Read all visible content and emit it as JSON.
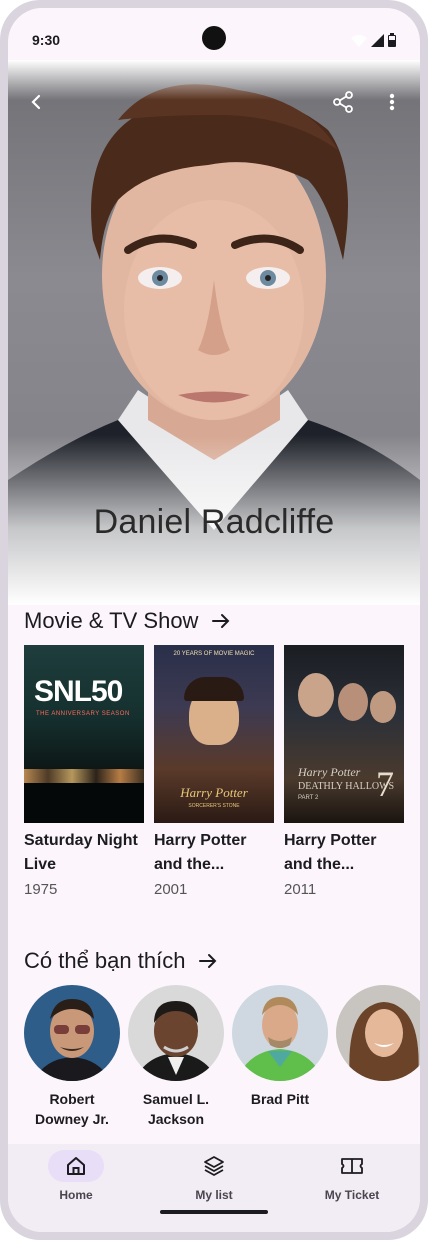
{
  "status_bar": {
    "time": "9:30"
  },
  "header": {
    "person_name": "Daniel Radcliffe",
    "back_icon": "back-arrow-icon",
    "share_icon": "share-icon",
    "more_icon": "more-vert-icon"
  },
  "movies_section": {
    "title": "Movie & TV Show",
    "items": [
      {
        "title": "Saturday Night Live",
        "year": "1975",
        "poster_text": "SNL50",
        "poster_subtext": "THE ANNIVERSARY SEASON"
      },
      {
        "title": "Harry Potter and the...",
        "year": "2001",
        "poster_text": "Harry Potter",
        "poster_subtext": "SORCERER'S STONE",
        "poster_top": "20 YEARS OF MOVIE MAGIC"
      },
      {
        "title": "Harry Potter and the...",
        "year": "2011",
        "poster_text": "Harry Potter",
        "poster_subtext": "DEATHLY HALLOWS",
        "poster_part": "PART 2",
        "poster_num": "7"
      }
    ]
  },
  "people_section": {
    "title": "Có thể bạn thích",
    "items": [
      {
        "name": "Robert Downey Jr."
      },
      {
        "name": "Samuel L. Jackson"
      },
      {
        "name": "Brad Pitt"
      },
      {
        "name": ""
      }
    ]
  },
  "bottom_nav": {
    "items": [
      {
        "label": "Home",
        "icon": "home-icon",
        "active": true
      },
      {
        "label": "My list",
        "icon": "layers-icon",
        "active": false
      },
      {
        "label": "My Ticket",
        "icon": "ticket-icon",
        "active": false
      }
    ]
  },
  "colors": {
    "background": "#fcf6fc",
    "nav_bg": "#f2ecf4",
    "active_pill": "#e8def8"
  }
}
